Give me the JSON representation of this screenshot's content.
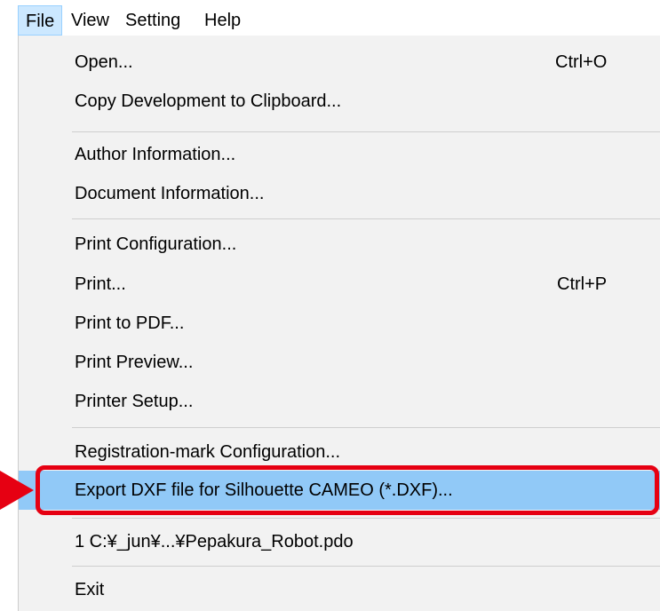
{
  "menubar": {
    "items": [
      {
        "label": "File"
      },
      {
        "label": "View"
      },
      {
        "label": "Setting"
      },
      {
        "label": "Help"
      }
    ]
  },
  "file_menu": {
    "open": {
      "label": "Open...",
      "shortcut": "Ctrl+O"
    },
    "copy_development": {
      "label": "Copy Development to Clipboard..."
    },
    "author_information": {
      "label": "Author Information..."
    },
    "document_information": {
      "label": "Document Information..."
    },
    "print_configuration": {
      "label": "Print Configuration..."
    },
    "print": {
      "label": "Print...",
      "shortcut": "Ctrl+P"
    },
    "print_to_pdf": {
      "label": "Print to PDF..."
    },
    "print_preview": {
      "label": "Print Preview..."
    },
    "printer_setup": {
      "label": "Printer Setup..."
    },
    "registration_mark": {
      "label": "Registration-mark Configuration..."
    },
    "export_dxf": {
      "label": "Export DXF file for Silhouette CAMEO (*.DXF)..."
    },
    "recent_file": {
      "label": "1 C:¥_jun¥...¥Pepakura_Robot.pdo"
    },
    "exit": {
      "label": "Exit"
    }
  },
  "colors": {
    "active_menu_bg": "#cce8ff",
    "highlight_bg": "#91c9f7",
    "callout": "#e60012",
    "dropdown_bg": "#f2f2f2"
  }
}
